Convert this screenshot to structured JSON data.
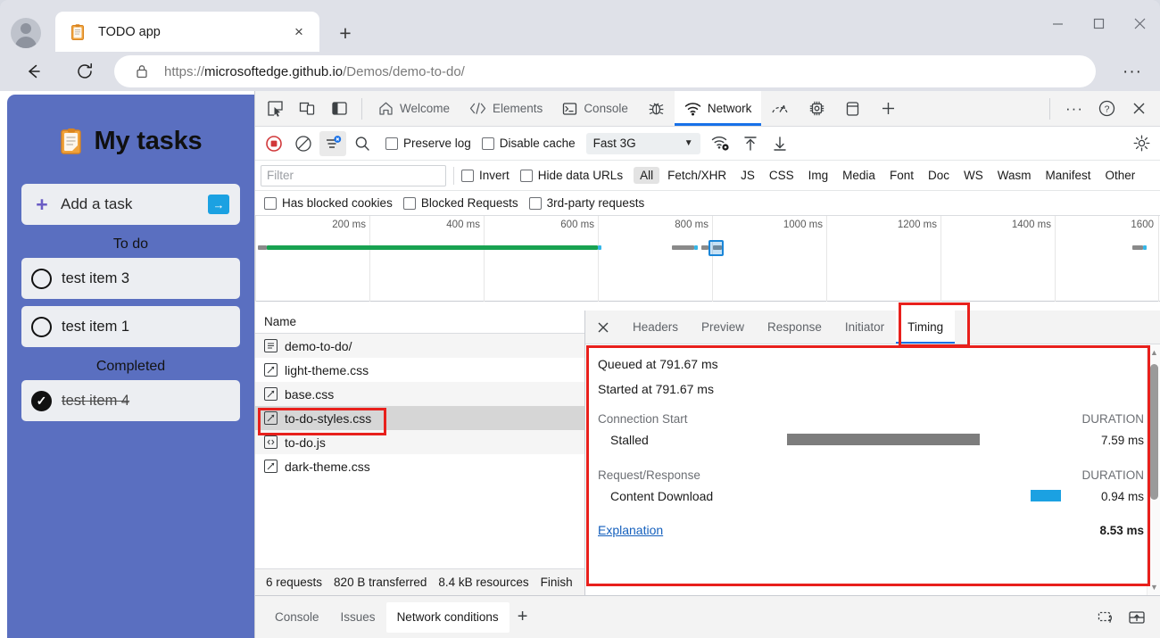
{
  "browser": {
    "tab": {
      "title": "TODO app",
      "favicon": "clipboard-icon",
      "close": "×"
    },
    "new_tab": "+",
    "window_controls": {
      "minimize": "—",
      "maximize": "☐",
      "close": "✕"
    },
    "nav": {
      "back": "←",
      "reload": "↻"
    },
    "url": {
      "scheme": "https://",
      "host": "microsoftedge.github.io",
      "path": "/Demos/demo-to-do/",
      "lock": "lock-icon"
    },
    "more": "···"
  },
  "todo_app": {
    "title": "My tasks",
    "add_task_placeholder": "Add a task",
    "add_plus": "+",
    "add_submit": "→",
    "sections": [
      {
        "label": "To do",
        "items": [
          {
            "text": "test item 3",
            "done": false
          },
          {
            "text": "test item 1",
            "done": false
          }
        ]
      },
      {
        "label": "Completed",
        "items": [
          {
            "text": "test item 4",
            "done": true
          }
        ]
      }
    ],
    "check_glyph": "✓"
  },
  "devtools": {
    "left_icons": [
      "inspect-icon",
      "device-toggle-icon",
      "dock-side-icon"
    ],
    "tabs": [
      {
        "label": "Welcome",
        "icon": "home-icon",
        "active": false
      },
      {
        "label": "Elements",
        "icon": "code-icon",
        "active": false
      },
      {
        "label": "Console",
        "icon": "console-icon",
        "active": false
      },
      {
        "label": "",
        "icon": "bug-icon",
        "active": false
      },
      {
        "label": "Network",
        "icon": "wifi-icon",
        "active": true
      },
      {
        "label": "",
        "icon": "performance-icon",
        "active": false
      },
      {
        "label": "",
        "icon": "memory-icon",
        "active": false
      },
      {
        "label": "",
        "icon": "application-icon",
        "active": false
      },
      {
        "label": "",
        "icon": "plus-icon",
        "active": false
      }
    ],
    "right_icons": {
      "more": "···",
      "help": "?",
      "close": "✕"
    },
    "network_toolbar": {
      "record": "record-stop-icon",
      "clear": "clear-icon",
      "filter": "filter-icon",
      "search": "search-icon",
      "preserve_log": "Preserve log",
      "disable_cache": "Disable cache",
      "throttling_value": "Fast 3G",
      "throttling_caret": "▼",
      "network_conditions_icon": "wifi-settings-icon",
      "import_icon": "import-har-icon",
      "export_icon": "export-har-icon",
      "settings_icon": "gear-icon"
    },
    "filter_bar": {
      "placeholder": "Filter",
      "invert": "Invert",
      "hide_data_urls": "Hide data URLs",
      "types": [
        "All",
        "Fetch/XHR",
        "JS",
        "CSS",
        "Img",
        "Media",
        "Font",
        "Doc",
        "WS",
        "Wasm",
        "Manifest",
        "Other"
      ],
      "selected_type": "All",
      "has_blocked_cookies": "Has blocked cookies",
      "blocked_requests": "Blocked Requests",
      "third_party_requests": "3rd-party requests"
    },
    "overview": {
      "ticks": [
        "200 ms",
        "400 ms",
        "600 ms",
        "800 ms",
        "1000 ms",
        "1200 ms",
        "1400 ms",
        "1600"
      ]
    },
    "requests": {
      "column_header": "Name",
      "rows": [
        {
          "name": "demo-to-do/",
          "icon": "document-icon",
          "selected": false
        },
        {
          "name": "light-theme.css",
          "icon": "stylesheet-icon",
          "selected": false
        },
        {
          "name": "base.css",
          "icon": "stylesheet-icon",
          "selected": false
        },
        {
          "name": "to-do-styles.css",
          "icon": "stylesheet-icon",
          "selected": true
        },
        {
          "name": "to-do.js",
          "icon": "script-icon",
          "selected": false
        },
        {
          "name": "dark-theme.css",
          "icon": "stylesheet-icon",
          "selected": false
        }
      ],
      "status": [
        "6 requests",
        "820 B transferred",
        "8.4 kB resources",
        "Finish"
      ]
    },
    "detail": {
      "close": "✕",
      "tabs": [
        "Headers",
        "Preview",
        "Response",
        "Initiator",
        "Timing"
      ],
      "active_tab": "Timing",
      "timing": {
        "queued": "Queued at 791.67 ms",
        "started": "Started at 791.67 ms",
        "groups": [
          {
            "name": "Connection Start",
            "duration_header": "DURATION",
            "rows": [
              {
                "label": "Stalled",
                "duration": "7.59 ms",
                "color": "#7d7d7d"
              }
            ]
          },
          {
            "name": "Request/Response",
            "duration_header": "DURATION",
            "rows": [
              {
                "label": "Content Download",
                "duration": "0.94 ms",
                "color": "#1ba1e2"
              }
            ]
          }
        ],
        "explanation_link": "Explanation",
        "total": "8.53 ms"
      }
    },
    "drawer": {
      "tabs": [
        {
          "label": "Console",
          "active": false
        },
        {
          "label": "Issues",
          "active": false
        },
        {
          "label": "Network conditions",
          "active": true
        }
      ],
      "plus": "+",
      "right_icons": [
        "screencast-icon",
        "drawer-toggle-icon"
      ]
    }
  },
  "annotations": {
    "highlight_color": "#e8201c",
    "boxes": [
      "request-to-do-styles-css",
      "timing-tab",
      "timing-panel"
    ]
  }
}
